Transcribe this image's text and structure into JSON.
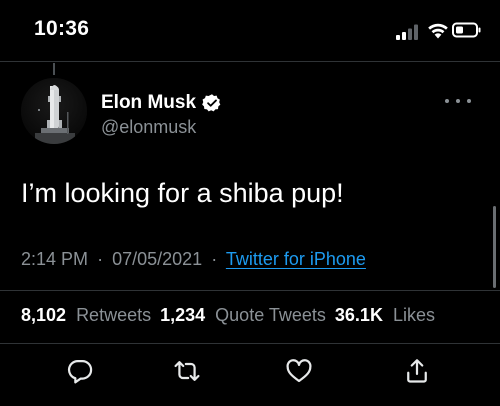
{
  "status_bar": {
    "time": "10:36",
    "icons": [
      "cellular-signal-icon",
      "wifi-icon",
      "battery-icon"
    ]
  },
  "tweet": {
    "display_name": "Elon Musk",
    "handle": "@elonmusk",
    "verified": true,
    "text": "I’m looking for a shiba pup!",
    "time": "2:14 PM",
    "separator": "·",
    "date": "07/05/2021",
    "source": "Twitter for iPhone"
  },
  "stats": [
    {
      "count": "8,102",
      "label": "Retweets"
    },
    {
      "count": "1,234",
      "label": "Quote Tweets"
    },
    {
      "count": "36.1K",
      "label": "Likes"
    }
  ],
  "actions": [
    "reply-icon",
    "retweet-icon",
    "like-icon",
    "share-icon"
  ],
  "colors": {
    "background": "#000000",
    "text": "#ffffff",
    "secondary_text": "#8b9196",
    "link": "#1d9bf0",
    "divider": "#2f3336"
  }
}
